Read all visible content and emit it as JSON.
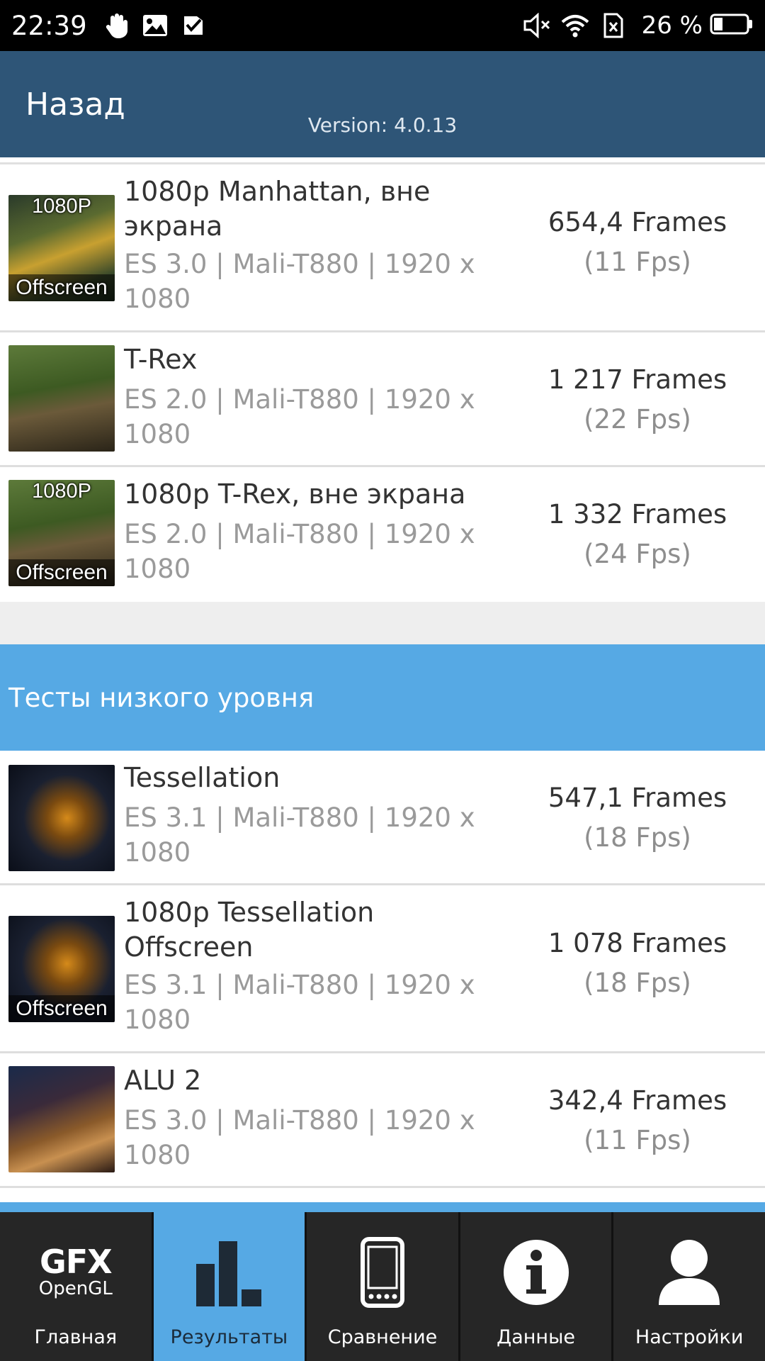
{
  "status_bar": {
    "time": "22:39",
    "battery_text": "26 %"
  },
  "header": {
    "back_label": "Назад",
    "version": "Version: 4.0.13"
  },
  "section1_rows": [
    {
      "title": "1080p Manhattan, вне экрана",
      "spec": "ES 3.0 | Mali-T880 | 1920 x 1080",
      "frames": "654,4 Frames",
      "fps": "(11 Fps)",
      "badge_top": "1080P",
      "badge_bottom": "Offscreen"
    },
    {
      "title": "T-Rex",
      "spec": "ES 2.0 | Mali-T880 | 1920 x 1080",
      "frames": "1 217 Frames",
      "fps": "(22 Fps)"
    },
    {
      "title": "1080p T-Rex, вне экрана",
      "spec": "ES 2.0 | Mali-T880 | 1920 x 1080",
      "frames": "1 332 Frames",
      "fps": "(24 Fps)",
      "badge_top": "1080P",
      "badge_bottom": "Offscreen"
    }
  ],
  "section2": {
    "header": "Тесты низкого уровня",
    "rows": [
      {
        "title": "Tessellation",
        "spec": "ES 3.1 | Mali-T880 | 1920 x 1080",
        "frames": "547,1 Frames",
        "fps": "(18 Fps)"
      },
      {
        "title": "1080p Tessellation Offscreen",
        "spec": "ES 3.1 | Mali-T880 | 1920 x 1080",
        "frames": "1 078 Frames",
        "fps": "(18 Fps)",
        "badge_bottom": "Offscreen"
      },
      {
        "title": "ALU 2",
        "spec": "ES 3.0 | Mali-T880 | 1920 x 1080",
        "frames": "342,4 Frames",
        "fps": "(11 Fps)"
      }
    ]
  },
  "bottom_nav": {
    "logo_top": "GFX",
    "logo_bottom": "OpenGL",
    "items": [
      {
        "label": "Главная",
        "icon": "gfx-logo"
      },
      {
        "label": "Результаты",
        "icon": "bar-chart-icon",
        "active": true
      },
      {
        "label": "Сравнение",
        "icon": "phone-icon"
      },
      {
        "label": "Данные",
        "icon": "info-icon"
      },
      {
        "label": "Настройки",
        "icon": "user-icon"
      }
    ]
  },
  "colors": {
    "header": "#2e5577",
    "accent": "#56a9e4",
    "nav_bg": "#262626"
  }
}
